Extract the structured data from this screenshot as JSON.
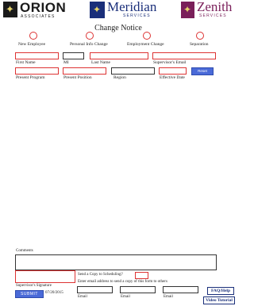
{
  "logos": {
    "orion": {
      "name": "ORION",
      "sub": "ASSOCIATES"
    },
    "meridian": {
      "name": "Meridian",
      "sub": "SERVICES"
    },
    "zenith": {
      "name": "Zenith",
      "sub": "SERVICES"
    }
  },
  "title": "Change Notice",
  "change_types": [
    {
      "label": "New Employee"
    },
    {
      "label": "Personal Info Change"
    },
    {
      "label": "Employment Change"
    },
    {
      "label": "Separation"
    }
  ],
  "fields_row1": {
    "first_name": "First Name",
    "mi": "MI",
    "last_name": "Last Name",
    "supervisor_email": "Supervisor's Email"
  },
  "fields_row2": {
    "present_program": "Present Program",
    "present_position": "Present Position",
    "region": "Region",
    "effective_date": "Effective Date"
  },
  "reset_label": "Reset",
  "comments_label": "Comments",
  "signature_label": "Supervisor's Signature",
  "submit_label": "SUBMIT",
  "date": "07/20/2015",
  "send_copy_label": "Send a Copy to Scheduling?",
  "email_instruction": "Enter email address to send a copy of this form to others",
  "email_labels": [
    "Email",
    "Email",
    "Email"
  ],
  "faq_label": "FAQ/Help",
  "video_label": "Video Tutorial",
  "colors": {
    "required_border": "#dd3333",
    "button_blue": "#4a6ad8",
    "meridian_navy": "#1a2f7a",
    "zenith_plum": "#7a1f5a"
  }
}
